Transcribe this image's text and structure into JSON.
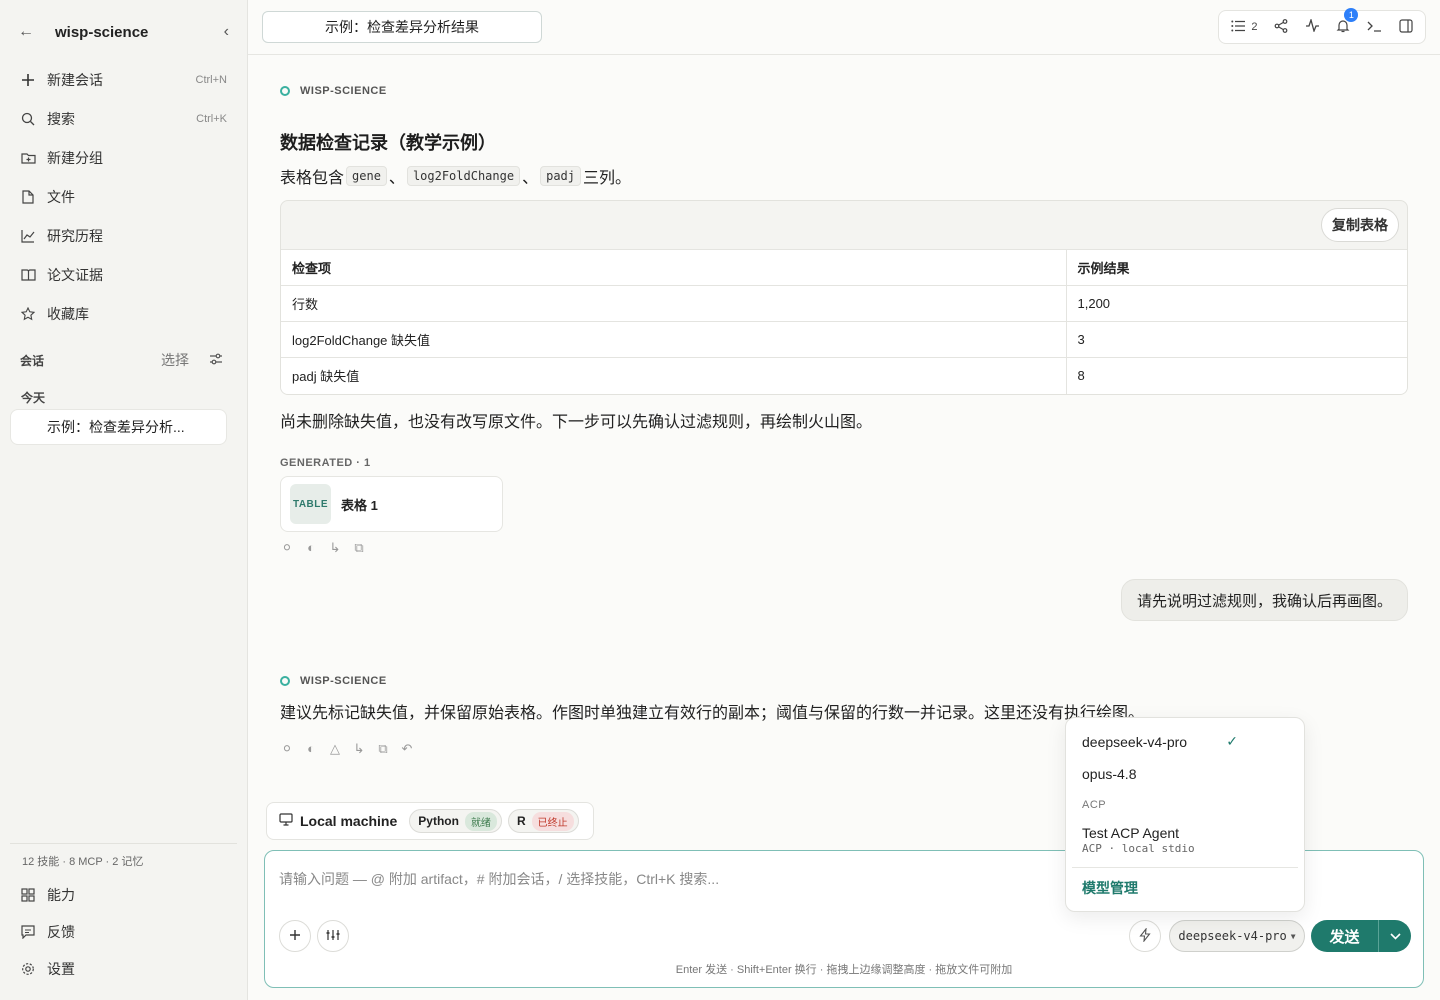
{
  "sidebar": {
    "title": "wisp-science",
    "nav": [
      {
        "label": "新建会话",
        "shortcut": "Ctrl+N",
        "icon": "plus-icon"
      },
      {
        "label": "搜索",
        "shortcut": "Ctrl+K",
        "icon": "search-icon"
      },
      {
        "label": "新建分组",
        "shortcut": "",
        "icon": "folder-plus-icon"
      },
      {
        "label": "文件",
        "shortcut": "",
        "icon": "file-icon"
      },
      {
        "label": "研究历程",
        "shortcut": "",
        "icon": "chart-line-icon"
      },
      {
        "label": "论文证据",
        "shortcut": "",
        "icon": "book-icon"
      },
      {
        "label": "收藏库",
        "shortcut": "",
        "icon": "star-icon"
      }
    ],
    "section_title": "会话",
    "select_label": "选择",
    "day_label": "今天",
    "conversation": "示例：检查差异分析...",
    "stats": "12 技能 · 8 MCP · 2 记忆",
    "bottom": [
      {
        "label": "能力",
        "icon": "grid-icon"
      },
      {
        "label": "反馈",
        "icon": "message-icon"
      },
      {
        "label": "设置",
        "icon": "gear-icon"
      }
    ]
  },
  "topbar": {
    "conversation_title": "示例：检查差异分析结果",
    "list_count": "2",
    "notification_count": "1"
  },
  "messages": {
    "agent_name": "WISP-SCIENCE",
    "heading": "数据检查记录（教学示例）",
    "intro_prefix": "表格包含",
    "columns": [
      "gene",
      "log2FoldChange",
      "padj"
    ],
    "sep": "、",
    "intro_suffix": "三列。",
    "copy_table": "复制表格",
    "table": {
      "headers": [
        "检查项",
        "示例结果"
      ],
      "rows": [
        [
          "行数",
          "1,200"
        ],
        [
          "log2FoldChange 缺失值",
          "3"
        ],
        [
          "padj 缺失值",
          "8"
        ]
      ]
    },
    "summary": "尚未删除缺失值，也没有改写原文件。下一步可以先确认过滤规则，再绘制火山图。",
    "generated_label": "GENERATED · 1",
    "artifact_type": "TABLE",
    "artifact_name": "表格 1",
    "user_message": "请先说明过滤规则，我确认后再画图。",
    "reply": "建议先标记缺失值，并保留原始表格。作图时单独建立有效行的副本；阈值与保留的行数一并记录。这里还没有执行绘图。"
  },
  "environment": {
    "machine": "Local machine",
    "kernels": [
      {
        "name": "Python",
        "status": "就绪"
      },
      {
        "name": "R",
        "status": "已终止"
      }
    ]
  },
  "composer": {
    "placeholder": "请输入问题 — @ 附加 artifact，# 附加会话，/ 选择技能，Ctrl+K 搜索...",
    "model": "deepseek-v4-pro",
    "send_label": "发送",
    "hint": "Enter 发送 · Shift+Enter 换行 · 拖拽上边缘调整高度 · 拖放文件可附加"
  },
  "model_menu": {
    "items": [
      "deepseek-v4-pro",
      "opus-4.8"
    ],
    "section": "ACP",
    "acp_agent": "Test ACP Agent",
    "acp_sub": "ACP · local stdio",
    "manage": "模型管理"
  },
  "colors": {
    "accent": "#1f7a6c",
    "sidebar_bg": "#f4f4f1",
    "page_bg": "#fbfbf9",
    "danger": "#c0392b"
  }
}
